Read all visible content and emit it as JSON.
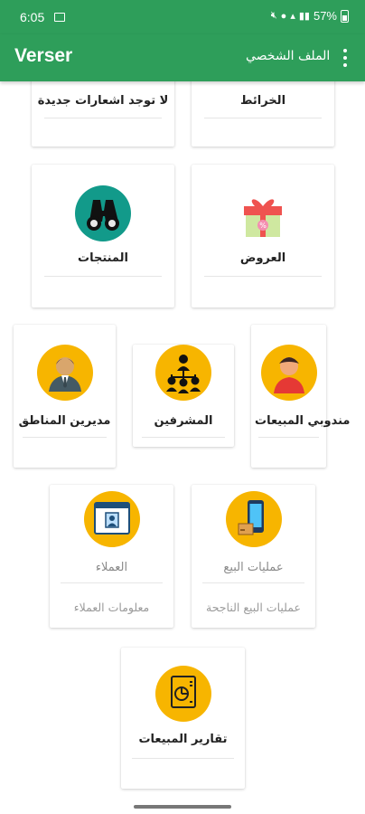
{
  "status_bar": {
    "time": "6:05",
    "battery": "57%"
  },
  "toolbar": {
    "title": "Verser",
    "profile_label": "الملف الشخصي"
  },
  "cards": {
    "notifications": {
      "label": "لا توجد اشعارات جديدة"
    },
    "maps": {
      "label": "الخرائط"
    },
    "products": {
      "label": "المنتجات"
    },
    "offers": {
      "label": "العروض"
    },
    "area_managers": {
      "label": "مديرين المناطق"
    },
    "supervisors": {
      "label": "المشرفين"
    },
    "sales_reps": {
      "label": "مندوبي المبيعات"
    },
    "customers": {
      "label": "العملاء",
      "sub": "معلومات العملاء"
    },
    "sales_ops": {
      "label": "عمليات البيع",
      "sub": "عمليات البيع الناجحة"
    },
    "sales_reports": {
      "label": "تقارير المبيعات"
    }
  },
  "icons": {
    "products": "binoculars-icon",
    "offers": "gift-box-icon",
    "area_managers": "businessman-icon",
    "supervisors": "team-hierarchy-icon",
    "sales_reps": "salesman-icon",
    "customers": "customer-card-icon",
    "sales_ops": "mobile-payment-icon",
    "sales_reports": "report-icon"
  },
  "colors": {
    "primary": "#2e9e5a",
    "icon_teal": "#129a8a",
    "icon_yellow": "#f7b500",
    "text_dark": "#222222",
    "text_muted": "#9b9b9b"
  }
}
